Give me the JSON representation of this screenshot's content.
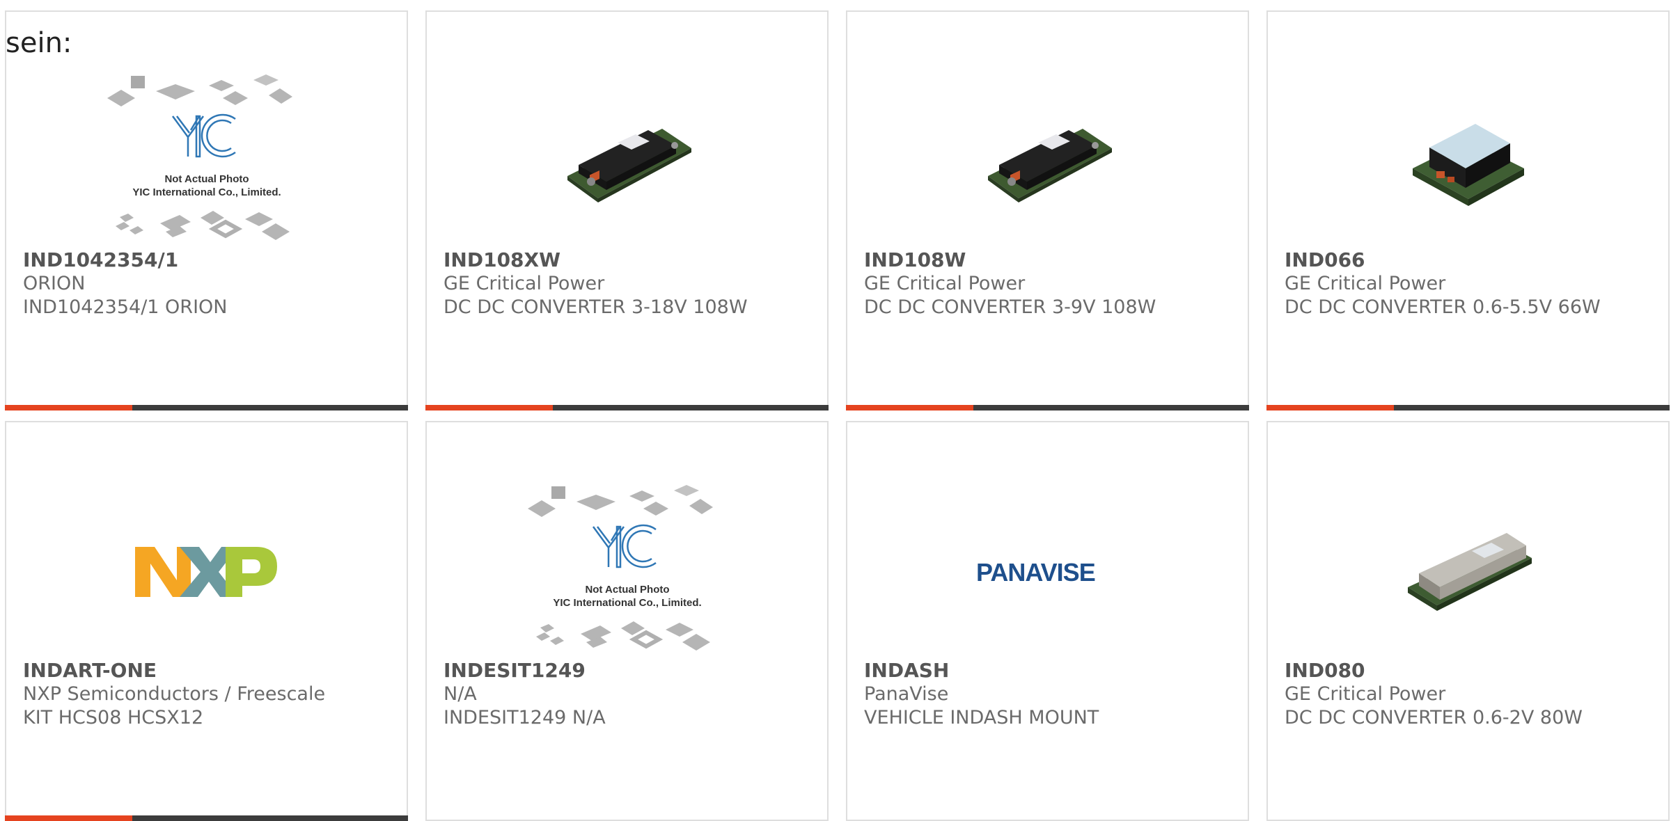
{
  "intro": "sein:",
  "placeholder": {
    "line1": "Not Actual Photo",
    "line2": "YIC International Co., Limited.",
    "logo_letters": "YIC"
  },
  "logos": {
    "nxp": "NXP",
    "panavise": "PANAVISE"
  },
  "colors": {
    "accent": "#e5431f",
    "bar": "#3c3c3c",
    "border": "#dedede",
    "title": "#555555",
    "text": "#6a6a6a"
  },
  "products": [
    {
      "part": "IND1042354/1",
      "manufacturer": "ORION",
      "description": "IND1042354/1 ORION",
      "image": "placeholder-yic"
    },
    {
      "part": "IND108XW",
      "manufacturer": "GE Critical Power",
      "description": "DC DC CONVERTER 3-18V 108W",
      "image": "module-long"
    },
    {
      "part": "IND108W",
      "manufacturer": "GE Critical Power",
      "description": "DC DC CONVERTER 3-9V 108W",
      "image": "module-long"
    },
    {
      "part": "IND066",
      "manufacturer": "GE Critical Power",
      "description": "DC DC CONVERTER 0.6-5.5V 66W",
      "image": "module-square"
    },
    {
      "part": "INDART-ONE",
      "manufacturer": "NXP Semiconductors / Freescale",
      "description": "KIT HCS08 HCSX12",
      "image": "logo-nxp"
    },
    {
      "part": "INDESIT1249",
      "manufacturer": "N/A",
      "description": "INDESIT1249 N/A",
      "image": "placeholder-yic"
    },
    {
      "part": "INDASH",
      "manufacturer": "PanaVise",
      "description": "VEHICLE INDASH MOUNT",
      "image": "logo-panavise"
    },
    {
      "part": "IND080",
      "manufacturer": "GE Critical Power",
      "description": "DC DC CONVERTER 0.6-2V 80W",
      "image": "module-metal"
    }
  ]
}
